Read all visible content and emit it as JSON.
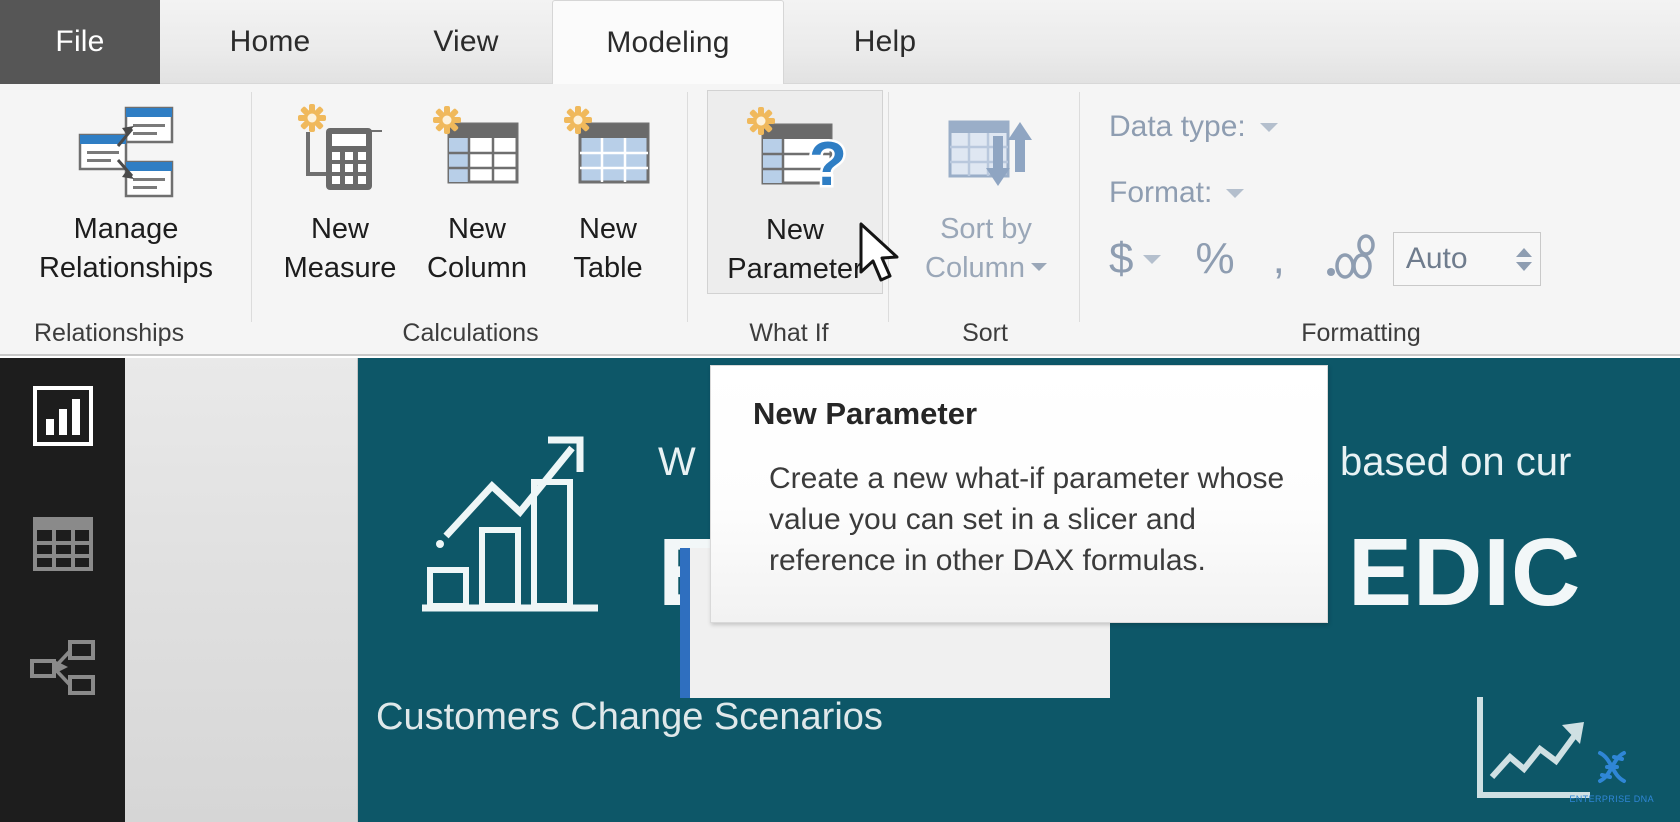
{
  "window": {
    "tabs": [
      {
        "id": "file",
        "label": "File",
        "active": false
      },
      {
        "id": "home",
        "label": "Home",
        "active": false
      },
      {
        "id": "view",
        "label": "View",
        "active": false
      },
      {
        "id": "modeling",
        "label": "Modeling",
        "active": true
      },
      {
        "id": "help",
        "label": "Help",
        "active": false
      }
    ]
  },
  "ribbon": {
    "groups": [
      {
        "id": "relationships",
        "label": "Relationships",
        "buttons": [
          {
            "id": "manage-relationships",
            "label": "Manage\nRelationships",
            "state": "enabled"
          }
        ]
      },
      {
        "id": "calculations",
        "label": "Calculations",
        "buttons": [
          {
            "id": "new-measure",
            "label": "New\nMeasure",
            "state": "enabled"
          },
          {
            "id": "new-column",
            "label": "New\nColumn",
            "state": "enabled"
          },
          {
            "id": "new-table",
            "label": "New\nTable",
            "state": "enabled"
          }
        ]
      },
      {
        "id": "what-if",
        "label": "What If",
        "buttons": [
          {
            "id": "new-parameter",
            "label": "New\nParameter",
            "state": "hovered"
          }
        ]
      },
      {
        "id": "sort",
        "label": "Sort",
        "buttons": [
          {
            "id": "sort-by-column",
            "label": "Sort by\nColumn",
            "state": "disabled",
            "has_dropdown": true
          }
        ]
      },
      {
        "id": "formatting",
        "label": "Formatting",
        "rows": [
          {
            "id": "data-type",
            "label": "Data type:",
            "has_dropdown": true,
            "state": "disabled"
          },
          {
            "id": "format",
            "label": "Format:",
            "has_dropdown": true,
            "state": "disabled"
          }
        ],
        "format_icons": [
          {
            "id": "currency",
            "glyph": "$",
            "has_dropdown": true
          },
          {
            "id": "percent",
            "glyph": "%",
            "has_dropdown": false
          },
          {
            "id": "thousands-separator",
            "glyph": ",",
            "has_dropdown": false
          },
          {
            "id": "decimal-places",
            "glyph": ".00",
            "has_dropdown": false
          }
        ],
        "decimal_field": {
          "id": "decimal-places-value",
          "value": "Auto"
        }
      }
    ]
  },
  "nav_rail": {
    "items": [
      {
        "id": "report-view",
        "icon": "bar-chart-icon",
        "active": true
      },
      {
        "id": "data-view",
        "icon": "table-grid-icon",
        "active": false
      },
      {
        "id": "model-view",
        "icon": "relationship-diagram-icon",
        "active": false
      }
    ]
  },
  "canvas": {
    "background_color": "#0d5768",
    "hero_icon": "growth-chart-icon",
    "headline_small": "W",
    "headline_small_right": "based on cur",
    "headline_big": "EDIC",
    "subtitle": "Customers Change Scenarios",
    "mini_chart_icon": "line-chart-icon",
    "logo_caption": "ENTERPRISE DNA"
  },
  "tooltip": {
    "title": "New Parameter",
    "body": "Create a new what-if parameter whose value you can set in a slicer and reference in other DAX formulas."
  },
  "cursor": {
    "type": "arrow-pointer"
  }
}
